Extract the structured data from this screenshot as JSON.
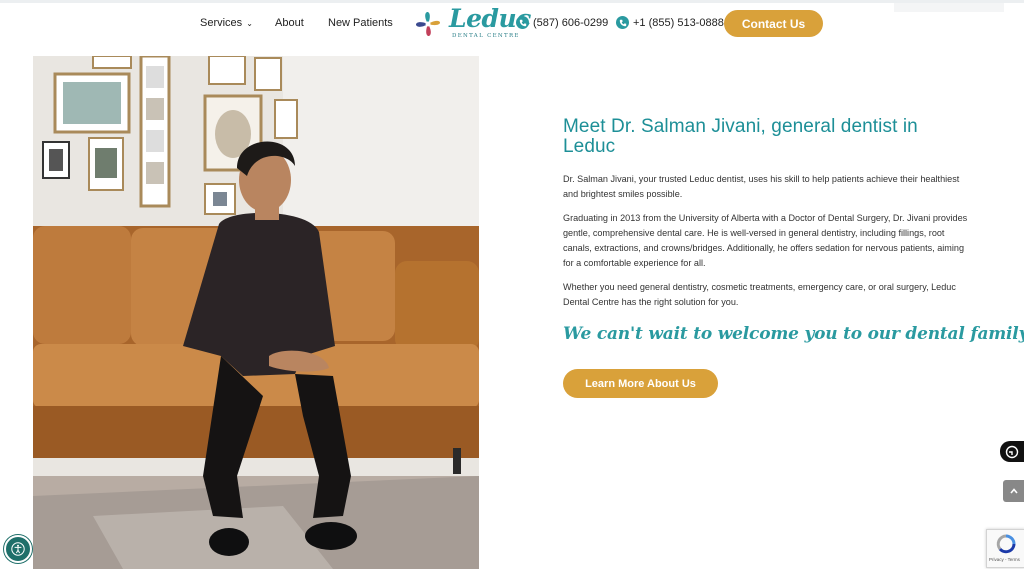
{
  "header": {
    "nav": [
      {
        "label": "Services"
      },
      {
        "label": "About"
      },
      {
        "label": "New Patients"
      }
    ],
    "logo": {
      "word": "Leduc",
      "subtitle": "DENTAL CENTRE"
    },
    "phones": [
      {
        "number": "(587) 606-0299",
        "icon": "phone-icon"
      },
      {
        "number": "+1 (855) 513-0888",
        "icon": "phone-icon"
      }
    ],
    "contact_label": "Contact Us"
  },
  "main": {
    "headline": "Meet Dr. Salman Jivani, general dentist in Leduc",
    "paragraphs": [
      "Dr. Salman Jivani, your trusted Leduc dentist, uses his skill to help patients achieve their healthiest and brightest smiles possible.",
      "Graduating in 2013 from the University of Alberta with a Doctor of Dental Surgery, Dr. Jivani provides gentle, comprehensive dental care. He is well-versed in general dentistry, including fillings, root canals, extractions, and crowns/bridges. Additionally, he offers sedation for nervous patients, aiming for a comfortable experience for all.",
      "Whether you need general dentistry, cosmetic treatments, emergency care, or oral surgery, Leduc Dental Centre has the right solution for you."
    ],
    "tagline": "We can't wait to welcome you to our dental family!",
    "cta_label": "Learn More About Us"
  },
  "recaptcha": {
    "links": "Privacy - Terms"
  },
  "colors": {
    "teal": "#2a9aa0",
    "gold": "#d9a13a",
    "dark_teal": "#1f6f6a"
  }
}
